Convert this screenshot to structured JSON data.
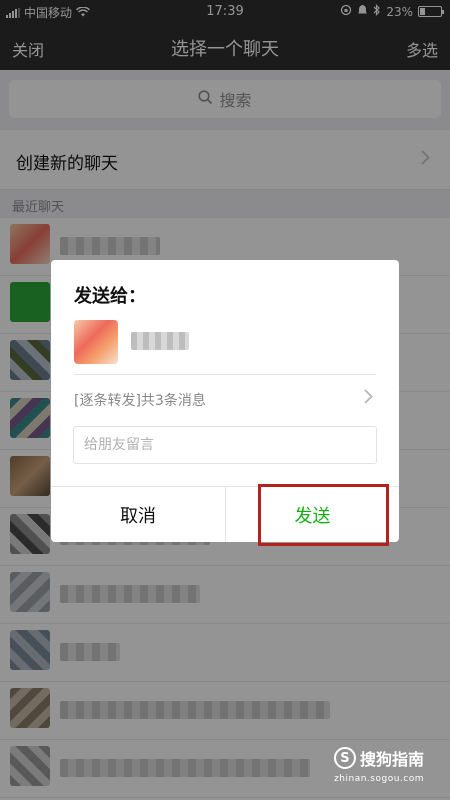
{
  "status_bar": {
    "carrier": "中国移动",
    "time": "17:39",
    "battery": "23%",
    "battery_level": 0.23
  },
  "nav": {
    "close_label": "关闭",
    "title": "选择一个聊天",
    "multi_select_label": "多选"
  },
  "search": {
    "placeholder": "搜索",
    "icon": "search-icon"
  },
  "new_chat": {
    "label": "创建新的聊天",
    "icon": "chevron-right-icon"
  },
  "recent_header": "最近聊天",
  "dialog": {
    "title": "发送给：",
    "summary": "[逐条转发]共3条消息",
    "message_placeholder": "给朋友留言",
    "cancel_label": "取消",
    "send_label": "发送"
  },
  "colors": {
    "send_green": "#1aad19",
    "highlight_red": "#b3221d",
    "nav_background": "#2f2f2f"
  },
  "watermark": {
    "brand": "搜狗指南",
    "url": "zhinan.sogou.com"
  }
}
